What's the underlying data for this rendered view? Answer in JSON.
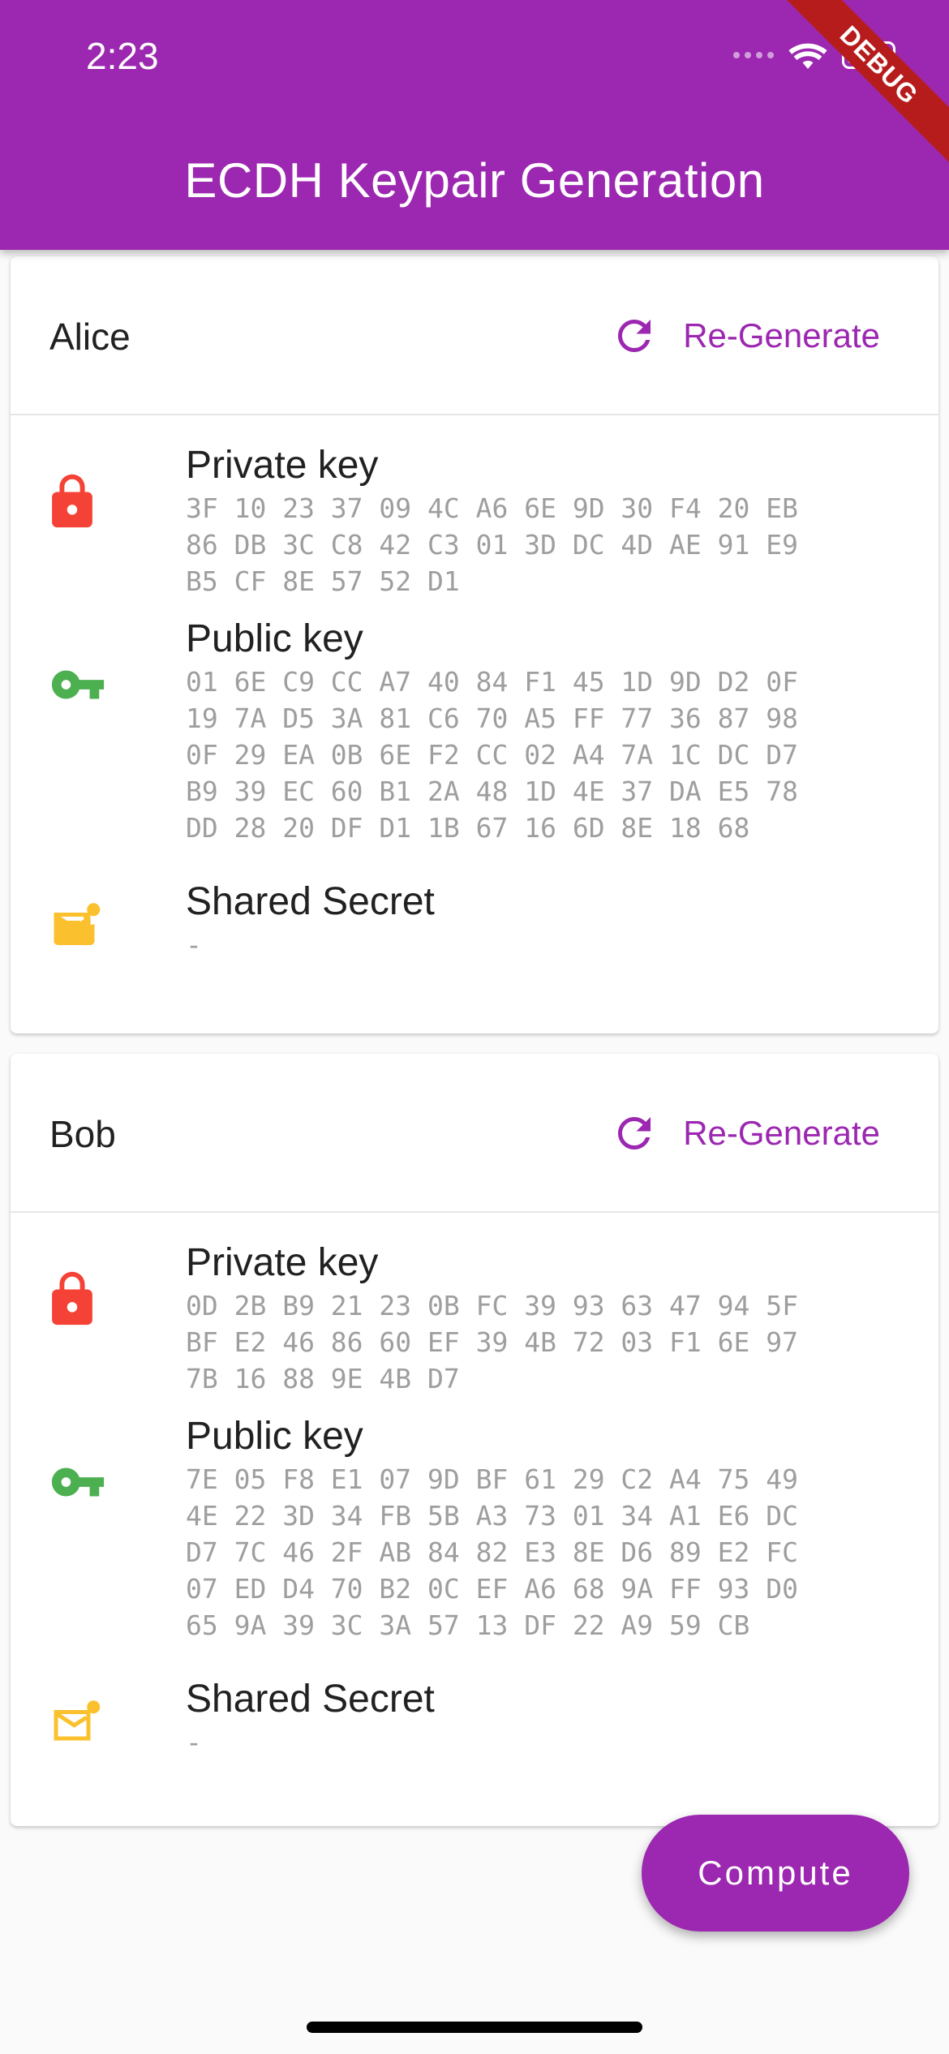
{
  "status_bar": {
    "time": "2:23"
  },
  "debug_banner": "DEBUG",
  "app_bar": {
    "title": "ECDH Keypair Generation"
  },
  "colors": {
    "primary": "#9c27b0",
    "lock": "#f44336",
    "key": "#4caf50",
    "mail": "#fbc02d"
  },
  "alice": {
    "name": "Alice",
    "regenerate_label": "Re-Generate",
    "private_key_label": "Private key",
    "private_key": "3F 10 23 37 09 4C A6 6E 9D 30 F4 20 EB\n86 DB 3C C8 42 C3 01 3D DC 4D AE 91 E9\nB5 CF 8E 57 52 D1",
    "public_key_label": "Public key",
    "public_key": "01 6E C9 CC A7 40 84 F1 45 1D 9D D2 0F\n19 7A D5 3A 81 C6 70 A5 FF 77 36 87 98\n0F 29 EA 0B 6E F2 CC 02 A4 7A 1C DC D7\nB9 39 EC 60 B1 2A 48 1D 4E 37 DA E5 78\nDD 28 20 DF D1 1B 67 16 6D 8E 18 68",
    "shared_secret_label": "Shared Secret",
    "shared_secret": "-"
  },
  "bob": {
    "name": "Bob",
    "regenerate_label": "Re-Generate",
    "private_key_label": "Private key",
    "private_key": "0D 2B B9 21 23 0B FC 39 93 63 47 94 5F\nBF E2 46 86 60 EF 39 4B 72 03 F1 6E 97\n7B 16 88 9E 4B D7",
    "public_key_label": "Public key",
    "public_key": "7E 05 F8 E1 07 9D BF 61 29 C2 A4 75 49\n4E 22 3D 34 FB 5B A3 73 01 34 A1 E6 DC\nD7 7C 46 2F AB 84 82 E3 8E D6 89 E2 FC\n07 ED D4 70 B2 0C EF A6 68 9A FF 93 D0\n65 9A 39 3C 3A 57 13 DF 22 A9 59 CB",
    "shared_secret_label": "Shared Secret",
    "shared_secret": "-"
  },
  "fab": {
    "label": "Compute"
  }
}
